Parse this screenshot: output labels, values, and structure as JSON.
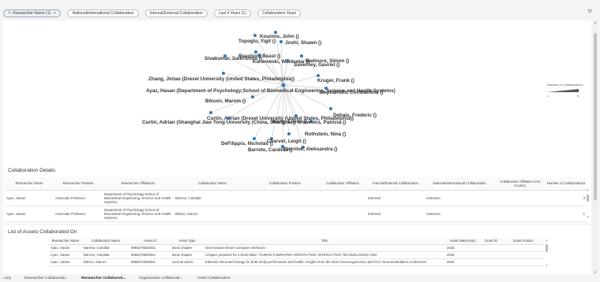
{
  "filters": {
    "chips": [
      {
        "label": "Researcher Name (1)",
        "active": true,
        "removable": true
      },
      {
        "label": "National/International Collaboration",
        "active": false,
        "removable": false
      },
      {
        "label": "Internal/External Collaboration",
        "active": false,
        "removable": false
      },
      {
        "label": "Last 4 Years (1)",
        "active": false,
        "removable": false
      },
      {
        "label": "Collaboration Years",
        "active": false,
        "removable": false
      }
    ],
    "filter_icon": "funnel-icon"
  },
  "network": {
    "accent_color": "#2f79b9",
    "center_node_label": "Ayaz, Hasan (Department of Psychology;School of Biomedical Engineering, Science and Health Systems)",
    "nodes": [
      "Kounios, John ()",
      "Topoglu, Yigit ()",
      "Joshi, Shawn ()",
      "Sivakumar, Saikrishna ()",
      "Karwowski, Waldemar ()",
      "Badouce, Simon ()",
      "Reaction, Beast ()",
      "Saverney, Gavriel ()",
      "Zhang, Jintao (Drexel University (United States, Philadelphia))",
      "Kruger, Frank ()",
      "Stephanidis, Constantine ()",
      "Bikson, Marom ()",
      "Dehais, Frederic ()",
      "Curtin, Adrian (Drexel University (United States, Philadelphia))",
      "Curtin, Adrian (Shanghai Jiao Tong University (China, Shanghai))",
      "Wang, Eileen ()",
      "Shewokis, Patricia ()",
      "Rothstein, Nina ()",
      "Charvet, Leigh ()",
      "DeFilippis, Nicholas ()",
      "Barreto, Candida ()",
      "Sternluk, Aleksandra ()"
    ],
    "legend": {
      "title": "Number of Collaborations",
      "min": "1",
      "max": "3"
    }
  },
  "details": {
    "title": "Collaboration Details",
    "columns": [
      "Researcher Name",
      "Researcher Position",
      "Researcher Affiliations",
      "Collaborator Name",
      "Collaborator Position",
      "Collaborator Affiliation",
      "Internal/External Collaboration",
      "National/International Collaboration",
      "Collaborator Affiliation Unit Country",
      "Number of Collaborations"
    ],
    "rows": [
      [
        "Ayaz, Hasan",
        "Associate Professor",
        "Department of Psychology;School of Biomedical Engineering, Science and Health Systems",
        "Barreto, Candida",
        "",
        "",
        "External",
        "Unknown",
        "",
        "3"
      ],
      [
        "Ayaz, Hasan",
        "Associate Professor",
        "Department of Psychology;School of Biomedical Engineering, Science and Health Systems",
        "Bikson, Marom",
        "",
        "",
        "External",
        "Unknown",
        "",
        "1"
      ]
    ]
  },
  "assets": {
    "title": "List of Assets Collaborated On",
    "columns": [
      "Researcher Name",
      "Collaborator Name",
      "Asset Id",
      "Asset Type",
      "Title",
      "Asset Date(Year)",
      "Grant ID",
      "Grant Funder"
    ],
    "rows": [
      [
        "Ayaz, Hasan",
        "Barreto, Candida",
        "9955276520021",
        "Book chapter",
        "Non-invasive Brain-Computer Interfaces",
        "2025",
        "",
        ""
      ],
      [
        "Ayaz, Hasan",
        "Barreto, Candida",
        "9955379820021",
        "Book chapter",
        "Chapter prepared for e-book titled: \"HUMAN-COMPUTER INTERACTION: INTERACTION TECHNOLOGIES AND",
        "2025",
        "",
        ""
      ],
      [
        "Ayaz, Hasan",
        "Bikson, Marom",
        "9955570500021",
        "Journal article",
        "Editorial: Neurotechnology for brain-body performance and health: insights from the 2022 Neuroergonomics and NYC Neuromodulation Conference",
        "2024",
        "",
        ""
      ]
    ]
  },
  "tabs": [
    "...tory",
    "Researcher Collaboratio...",
    "Researcher Collaborati...",
    "Organization Collaborati...",
    "Asset Collaboration"
  ],
  "active_tab": 2
}
